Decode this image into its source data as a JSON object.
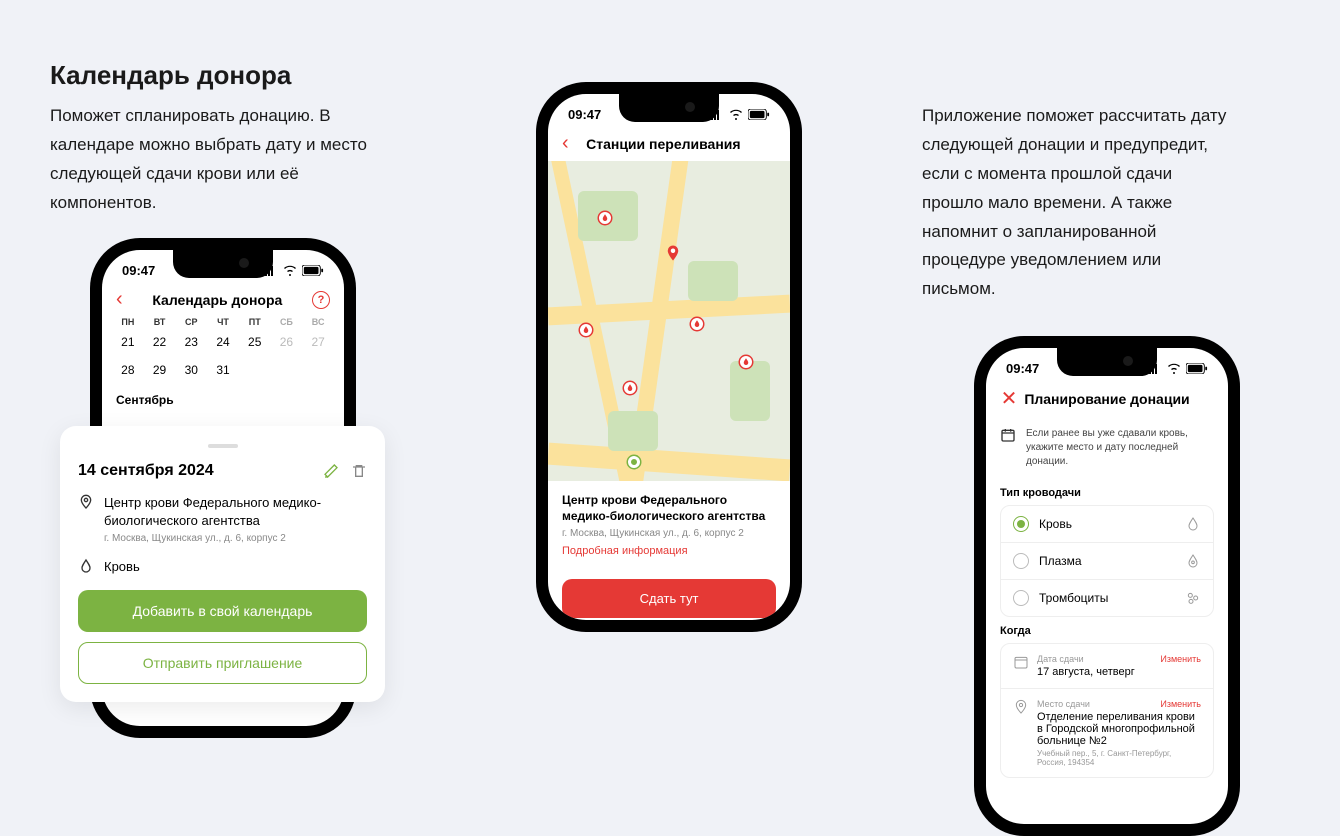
{
  "heading": "Календарь донора",
  "desc_left": "Поможет спланировать донацию. В календаре можно выбрать дату и место следующей сдачи крови или её компонентов.",
  "desc_right": "Приложение поможет рассчитать дату следующей донации и предупредит, если с момента прошлой сдачи прошло мало времени. А также напомнит о запланированной процедуре уведомлением или письмом.",
  "status_time": "09:47",
  "phone1": {
    "title": "Календарь донора",
    "weekdays": [
      "ПН",
      "ВТ",
      "СР",
      "ЧТ",
      "ПТ",
      "СБ",
      "ВС"
    ],
    "month": "Сентябрь",
    "rows": [
      [
        "21",
        "22",
        "23",
        "24",
        "25",
        "26",
        "27"
      ],
      [
        "28",
        "29",
        "30",
        "31",
        "",
        "",
        ""
      ]
    ]
  },
  "event": {
    "date": "14 сентября 2024",
    "center": "Центр крови Федерального медико-биологического агентства",
    "addr": "г. Москва, Щукинская ул., д. 6, корпус 2",
    "type": "Кровь",
    "btn_add": "Добавить в свой календарь",
    "btn_invite": "Отправить приглашение"
  },
  "phone2": {
    "title": "Станции переливания",
    "center": "Центр крови Федерального медико-биологического агентства",
    "addr": "г. Москва, Щукинская ул., д. 6, корпус 2",
    "details": "Подробная информация",
    "btn": "Сдать тут"
  },
  "phone3": {
    "title": "Планирование донации",
    "banner": "Если ранее вы уже сдавали кровь, укажите место и дату последней донации.",
    "type_label": "Тип кроводачи",
    "types": [
      "Кровь",
      "Плазма",
      "Тромбоциты"
    ],
    "when_label": "Когда",
    "change": "Изменить",
    "date_label": "Дата сдачи",
    "date_value": "17 августа, четверг",
    "place_label": "Место сдачи",
    "place_value": "Отделение переливания крови в Городской многопрофильной больнице №2",
    "place_addr": "Учебный пер., 5, г. Санкт-Петербург, Россия, 194354"
  }
}
